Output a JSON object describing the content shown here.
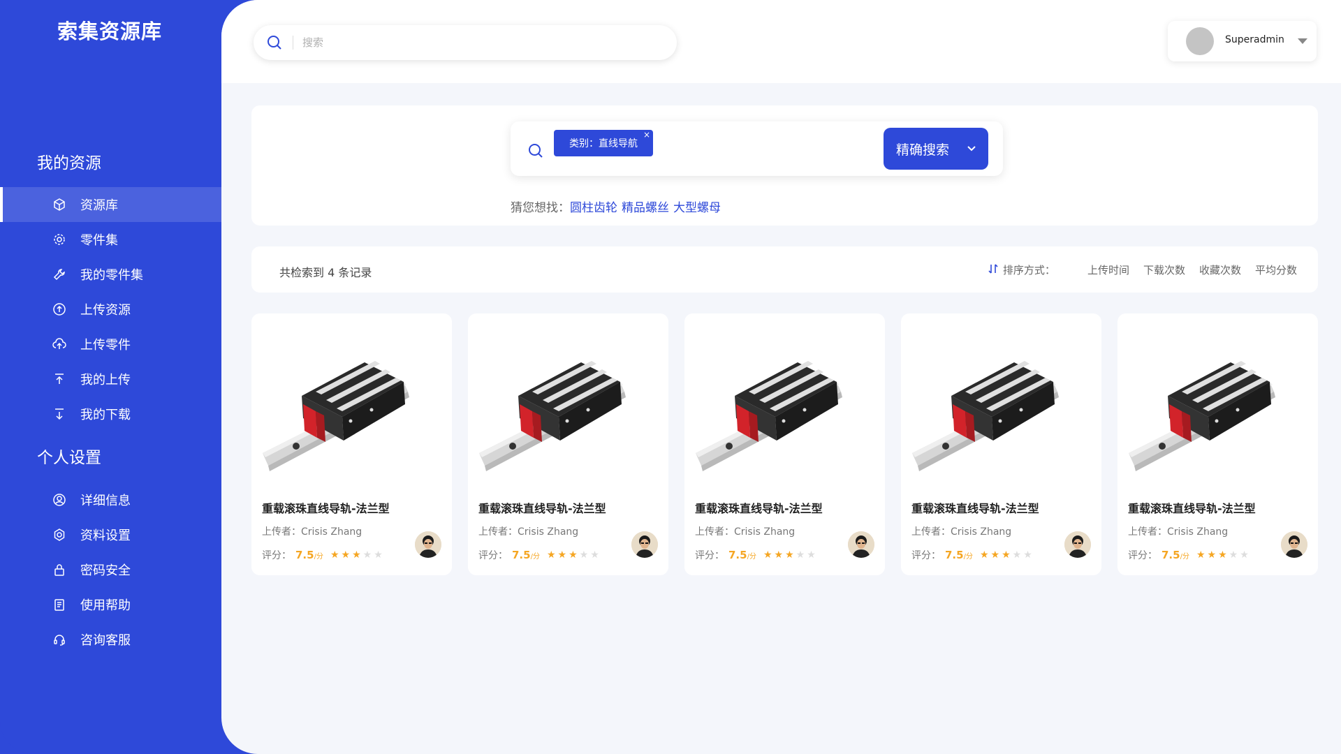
{
  "app": {
    "title": "索集资源库"
  },
  "sidebar": {
    "section_resources": "我的资源",
    "resource_items": [
      {
        "label": "资源库",
        "icon": "cube-icon",
        "active": true
      },
      {
        "label": "零件集",
        "icon": "gear-icon"
      },
      {
        "label": "我的零件集",
        "icon": "wrench-icon"
      },
      {
        "label": "上传资源",
        "icon": "upload-circle-icon"
      },
      {
        "label": "上传零件",
        "icon": "cloud-upload-icon"
      },
      {
        "label": "我的上传",
        "icon": "arrow-up-icon"
      },
      {
        "label": "我的下载",
        "icon": "arrow-down-icon"
      }
    ],
    "section_settings": "个人设置",
    "settings_items": [
      {
        "label": "详细信息",
        "icon": "user-circle-icon"
      },
      {
        "label": "资料设置",
        "icon": "settings-icon"
      },
      {
        "label": "密码安全",
        "icon": "lock-icon"
      },
      {
        "label": "使用帮助",
        "icon": "document-icon"
      },
      {
        "label": "咨询客服",
        "icon": "headset-icon"
      }
    ]
  },
  "topbar": {
    "search_placeholder": "搜索",
    "user_name": "Superadmin"
  },
  "search": {
    "tag_label": "类别：直线导航",
    "tag_close": "×",
    "exact_button": "精确搜索",
    "guess_label": "猜您想找：",
    "guess_items": [
      "圆柱齿轮",
      "精品螺丝",
      "大型螺母"
    ]
  },
  "results": {
    "count_text": "共检索到 4 条记录",
    "sort_label": "排序方式：",
    "sort_options": [
      "上传时间",
      "下载次数",
      "收藏次数",
      "平均分数"
    ]
  },
  "cards": [
    {
      "title": "重载滚珠直线导轨-法兰型",
      "uploader_label": "上传者：",
      "uploader": "Crisis Zhang",
      "rating_label": "评分：",
      "score": "7.5",
      "unit": "/分",
      "stars": 3
    },
    {
      "title": "重载滚珠直线导轨-法兰型",
      "uploader_label": "上传者：",
      "uploader": "Crisis Zhang",
      "rating_label": "评分：",
      "score": "7.5",
      "unit": "/分",
      "stars": 3
    },
    {
      "title": "重载滚珠直线导轨-法兰型",
      "uploader_label": "上传者：",
      "uploader": "Crisis Zhang",
      "rating_label": "评分：",
      "score": "7.5",
      "unit": "/分",
      "stars": 3
    },
    {
      "title": "重载滚珠直线导轨-法兰型",
      "uploader_label": "上传者：",
      "uploader": "Crisis Zhang",
      "rating_label": "评分：",
      "score": "7.5",
      "unit": "/分",
      "stars": 3
    },
    {
      "title": "重载滚珠直线导轨-法兰型",
      "uploader_label": "上传者：",
      "uploader": "Crisis Zhang",
      "rating_label": "评分：",
      "score": "7.5",
      "unit": "/分",
      "stars": 3
    }
  ],
  "colors": {
    "brand": "#2e49d9",
    "star": "#f5a623",
    "background": "#f4f6fb"
  }
}
